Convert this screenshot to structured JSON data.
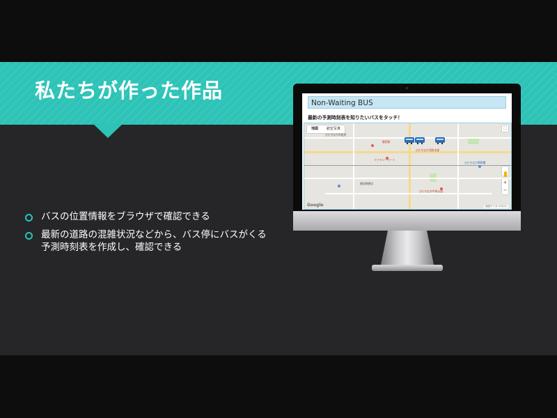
{
  "slide": {
    "title": "私たちが作った作品",
    "bullets": [
      "バスの位置情報をブラウザで確認できる",
      "最新の道路の混雑状況などから、バス停にバスがくる予測時刻表を作成し、確認できる"
    ]
  },
  "app": {
    "header_title": "Non-Waiting BUS",
    "instruction": "最新の予測時刻表を知りたいバスをタッチ！",
    "map": {
      "tabs": [
        "地図",
        "航空写真"
      ],
      "zoom_in": "+",
      "zoom_out": "−",
      "fullscreen": "⛶",
      "logo": "Google",
      "attribution": "地図データ ©2021",
      "labels": [
        "ひたちなか市役所",
        "勝田駅",
        "ひたちなか消防本部",
        "ひたちなか警察署",
        "勝田郵便局",
        "ファミリーマート",
        "ひたちなか中央公園"
      ]
    }
  },
  "colors": {
    "accent": "#2dc3b7",
    "slide_background": "#262628",
    "bus": "#2b6cb8"
  }
}
